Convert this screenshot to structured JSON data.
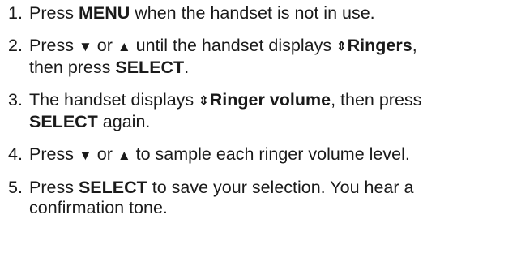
{
  "steps": [
    {
      "num": "1.",
      "parts": [
        "Press ",
        "MENU",
        " when the handset is not in use."
      ]
    },
    {
      "num": "2.",
      "parts": [
        "Press ",
        "▼",
        " or ",
        "▲",
        " until the handset displays ",
        "⇕",
        "Ringers",
        ",",
        "then press ",
        "SELECT",
        "."
      ]
    },
    {
      "num": "3.",
      "parts": [
        "The handset displays ",
        "⇕",
        "Ringer volume",
        ", then press",
        "SELECT",
        " again."
      ]
    },
    {
      "num": "4.",
      "parts": [
        "Press ",
        "▼",
        " or ",
        "▲",
        " to sample each ringer volume level."
      ]
    },
    {
      "num": "5.",
      "parts": [
        "Press ",
        "SELECT",
        " to save your selection. You hear a",
        "confirmation tone."
      ]
    }
  ]
}
